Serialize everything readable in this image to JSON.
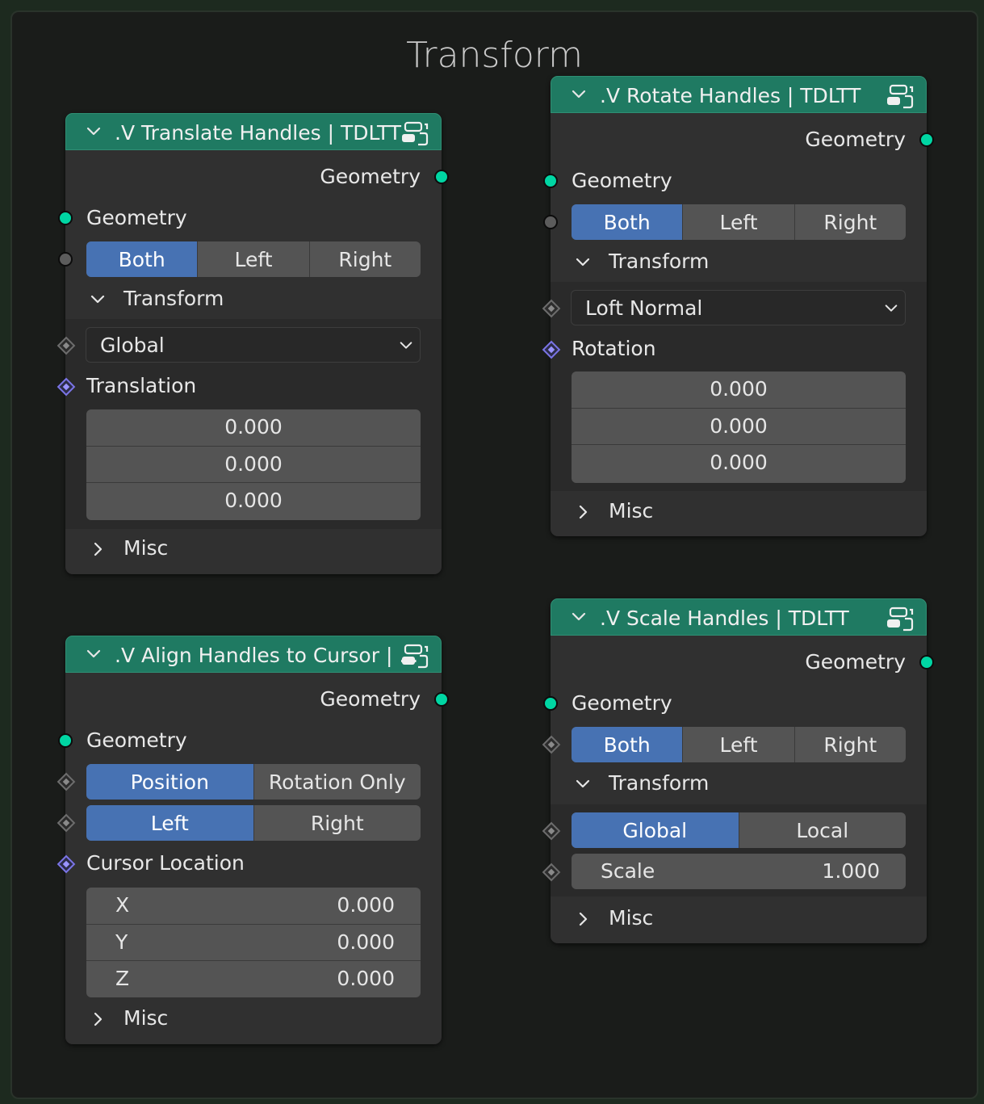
{
  "frame": {
    "title": "Transform"
  },
  "colors": {
    "header": "#1f7a62",
    "active": "#4772b3",
    "geometry_socket": "#00d6a3",
    "vector_socket": "#7a74e6"
  },
  "nodes": {
    "translate": {
      "title": ".V Translate Handles | TDLTT",
      "output_label": "Geometry",
      "input_label": "Geometry",
      "mode": [
        "Both",
        "Left",
        "Right"
      ],
      "mode_selected": "Both",
      "panel_label": "Transform",
      "space_value": "Global",
      "vector_label": "Translation",
      "vector": [
        "0.000",
        "0.000",
        "0.000"
      ],
      "misc_label": "Misc"
    },
    "rotate": {
      "title": ".V Rotate Handles | TDLTT",
      "output_label": "Geometry",
      "input_label": "Geometry",
      "mode": [
        "Both",
        "Left",
        "Right"
      ],
      "mode_selected": "Both",
      "panel_label": "Transform",
      "space_value": "Loft Normal",
      "vector_label": "Rotation",
      "vector": [
        "0.000",
        "0.000",
        "0.000"
      ],
      "misc_label": "Misc"
    },
    "align": {
      "title": ".V Align Handles to Cursor | ...",
      "output_label": "Geometry",
      "input_label": "Geometry",
      "mode": [
        "Position",
        "Rotation Only"
      ],
      "mode_selected": "Position",
      "side": [
        "Left",
        "Right"
      ],
      "side_selected": "Left",
      "vector_label": "Cursor Location",
      "vector": [
        {
          "axis": "X",
          "value": "0.000"
        },
        {
          "axis": "Y",
          "value": "0.000"
        },
        {
          "axis": "Z",
          "value": "0.000"
        }
      ],
      "misc_label": "Misc"
    },
    "scale": {
      "title": ".V Scale Handles | TDLTT",
      "output_label": "Geometry",
      "input_label": "Geometry",
      "mode": [
        "Both",
        "Left",
        "Right"
      ],
      "mode_selected": "Both",
      "panel_label": "Transform",
      "space": [
        "Global",
        "Local"
      ],
      "space_selected": "Global",
      "scale_label": "Scale",
      "scale_value": "1.000",
      "misc_label": "Misc"
    }
  }
}
